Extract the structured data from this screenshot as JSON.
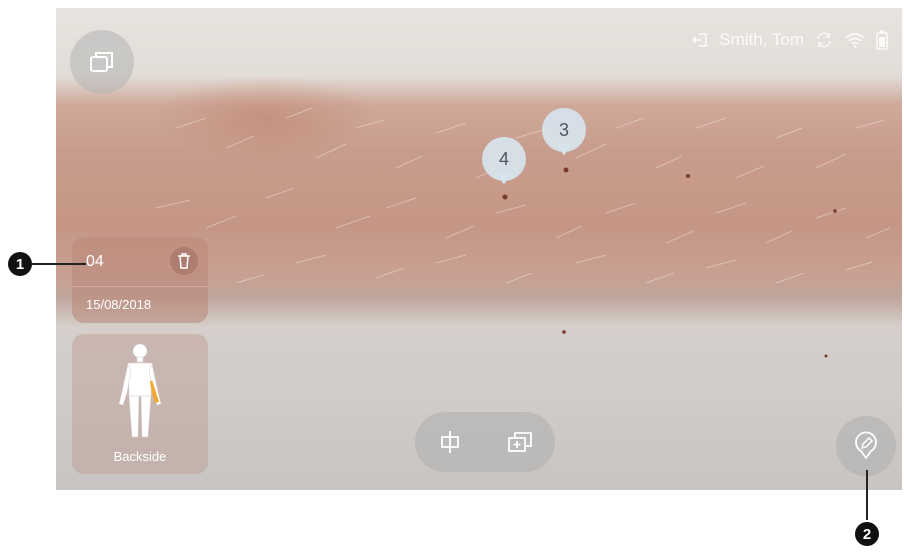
{
  "status_bar": {
    "user_name": "Smith, Tom",
    "icons": [
      "logout-icon",
      "sync-icon",
      "wifi-icon",
      "battery-icon"
    ]
  },
  "markers": [
    {
      "number": "3"
    },
    {
      "number": "4"
    }
  ],
  "lesion_card": {
    "number": "04",
    "date": "15/08/2018"
  },
  "body_map": {
    "label": "Backside",
    "highlight_color": "#f0a830"
  },
  "toolbar": {
    "icons": [
      "center-icon",
      "add-image-icon"
    ]
  },
  "callouts": {
    "first": "1",
    "second": "2"
  }
}
